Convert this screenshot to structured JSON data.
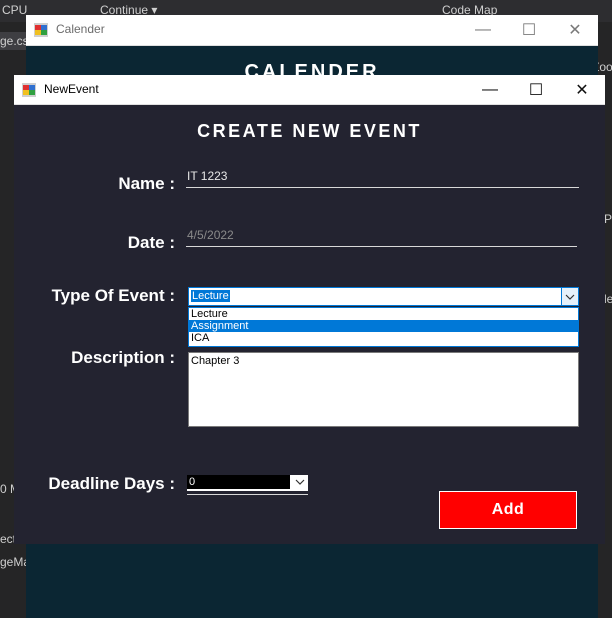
{
  "ide": {
    "toolbar_cpu": "CPU",
    "toolbar_continue": "Continue ▾",
    "toolbar_codemap": "Code Map",
    "file_tab": "ge.cs",
    "zoom_frag": "Zoo",
    "p_frag": "P",
    "le_frag": "le",
    "zero_m": "0 M",
    "ect": "ect",
    "gema": "geMa"
  },
  "calendar_window": {
    "title": "Calender",
    "heading": "CALENDER"
  },
  "new_event_window": {
    "title": "NewEvent",
    "form_title": "CREATE NEW EVENT",
    "name": {
      "label": "Name :",
      "value": "IT 1223"
    },
    "date": {
      "label": "Date :",
      "value": "4/5/2022"
    },
    "type_of_event": {
      "label": "Type Of Event :",
      "selected": "Lecture",
      "options": [
        "Lecture",
        "Assignment",
        "ICA"
      ],
      "highlighted_index": 1
    },
    "description": {
      "label": "Description :",
      "value": "Chapter 3"
    },
    "deadline_days": {
      "label": "Deadline Days :",
      "value": "0"
    },
    "add_button": "Add"
  },
  "colors": {
    "dialog_bg": "#232330",
    "calendar_bg": "#0b2633",
    "accent": "#0078d7",
    "add_button": "#ff0000"
  }
}
